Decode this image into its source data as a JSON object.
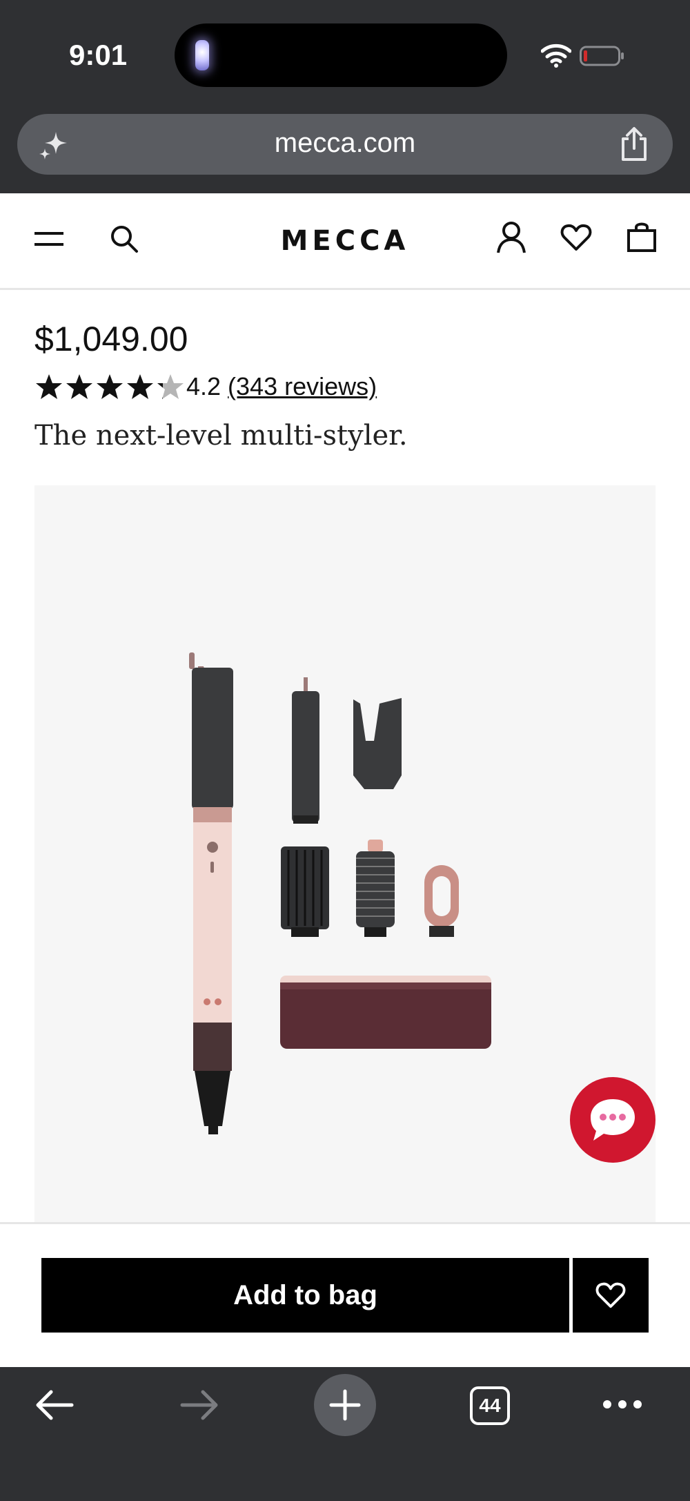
{
  "status_bar": {
    "time": "9:01",
    "icons": [
      "flashlight-indicator",
      "wifi-icon",
      "battery-low-icon"
    ],
    "battery_color": "#d12b2b"
  },
  "browser": {
    "url": "mecca.com",
    "icons": [
      "sparkle-icon",
      "share-icon"
    ],
    "toolbar": {
      "tab_count": "44",
      "icons": [
        "back-arrow-icon",
        "forward-arrow-icon",
        "plus-icon",
        "tabs-icon",
        "more-icon"
      ]
    }
  },
  "site_header": {
    "logo": "MECCA",
    "icons": [
      "menu-icon",
      "search-icon",
      "account-icon",
      "heart-icon",
      "bag-icon"
    ]
  },
  "product": {
    "price": "$1,049.00",
    "rating": 4.2,
    "rating_text": "4.2",
    "reviews_text": "(343 reviews)",
    "tagline": "The next-level multi-styler.",
    "image_description_icon": "multi-styler-product-image"
  },
  "actions": {
    "add_to_bag": "Add to bag",
    "wishlist_icon": "heart-icon"
  },
  "chat": {
    "icon": "chat-bubble-icon",
    "color": "#d0172f"
  },
  "colors": {
    "chrome": "#2f3033",
    "url_bar": "#5a5c61",
    "primary_button": "#000000"
  }
}
